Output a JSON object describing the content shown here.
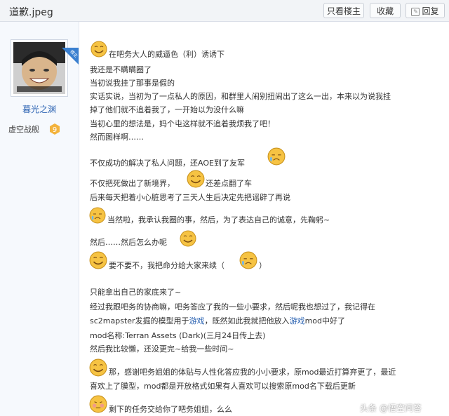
{
  "header": {
    "title": "道歉.jpeg",
    "btn_only_op": "只看楼主",
    "btn_collect": "收藏",
    "btn_reply": "回复"
  },
  "user": {
    "corner_badge": "楼主",
    "name": "暮光之渊",
    "rank": "虚空战舰",
    "level": "9"
  },
  "post": {
    "l1": "在吧务大人的威逼色（利）诱诱下",
    "l2": "我还是不瞒瞒圈了",
    "l3": "当初说我挂了那事是假的",
    "l4": "实话实说，当初为了一点私人的原因，和群里人闹别扭闹出了这么一出，本来以为说我挂",
    "l5": "掉了他们就不追着我了，一开始以为没什么嘛",
    "l6": "当初心里的想法是，妈个屯这样就不追着我烦我了吧！",
    "l7": "然而图样啊……",
    "l8": "不仅成功的解决了私人问题，还AOE到了友军",
    "l9": "不仅把死做出了新境界，",
    "l9b": "还差点翻了车",
    "l10": "后来每天把着小心脏思考了三天人生后决定先把谣辟了再说",
    "l11": "当然啦，我承认我圈的事，然后，为了表达自己的诚意，先鞠躬~",
    "l12": "然后……然后怎么办呢",
    "l13": "要不要不，我把命分给大家来续（",
    "l13b": "）",
    "l14": "只能拿出自己的家底来了~",
    "l15": "经过我跟吧务的协商嘛，吧务答应了我的一些小要求，然后呢我也想过了，我记得在",
    "l16a": "sc2mapster发掘的模型用于",
    "l16link1": "游戏",
    "l16b": "，既然如此我就把他放入",
    "l16link2": "游戏",
    "l16c": "mod中好了",
    "l17": "mod名称:Terran Assets (Dark)(三月24日传上去)",
    "l18": "然后我比较懒，还没更完~给我一些时间~",
    "l19": "那，感谢吧务姐姐的体贴与人性化答应我的小小要求，原mod最近打算弃更了，最近",
    "l20": "喜欢上了膜型，mod都是开放格式如果有人喜欢可以搜索原mod名下载后更新",
    "l21": "剩下的任务交给你了吧务姐姐，么么"
  },
  "watermark": "头条 @悟空问答",
  "colors": {
    "link": "#2d64b3",
    "emoji": "#f6c343",
    "badge": "#3a80d0"
  }
}
